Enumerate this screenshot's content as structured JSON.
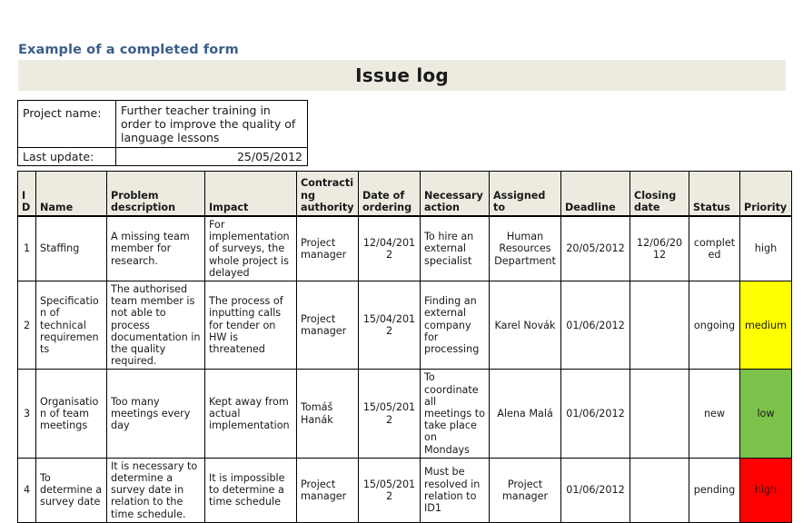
{
  "page": {
    "heading": "Example of a completed form",
    "title": "Issue log",
    "heading_color": "#3c5d8a",
    "banner_color": "#edebe0"
  },
  "info_box": {
    "project_name_label": "Project name:",
    "project_name_value": "Further teacher training in order to improve the quality of language lessons",
    "last_update_label": "Last update:",
    "last_update_value": "25/05/2012"
  },
  "table": {
    "headers": [
      "ID",
      "Name",
      "Problem description",
      "Impact",
      "Contracting authority",
      "Date of ordering",
      "Necessary action",
      "Assigned to",
      "Deadline",
      "Closing date",
      "Status",
      "Priority"
    ],
    "rows": [
      {
        "id": "1",
        "name": "Staffing",
        "problem": "A missing team member for research.",
        "impact": "For implementation of surveys, the whole project is delayed",
        "contracting_authority": "Project manager",
        "date_of_ordering": "12/04/2012",
        "necessary_action": "To hire an external specialist",
        "assigned_to": "Human Resources Department",
        "deadline": "20/05/2012",
        "closing_date": "12/06/2012",
        "status": "completed",
        "priority": "high",
        "priority_color": "#ffffff"
      },
      {
        "id": "2",
        "name": "Specification of technical requirements",
        "problem": "The authorised team member is not able to process documentation in the quality required.",
        "impact": "The process of inputting calls for tender on HW is threatened",
        "contracting_authority": "Project manager",
        "date_of_ordering": "15/04/2012",
        "necessary_action": "Finding an external company for processing",
        "assigned_to": "Karel Novák",
        "deadline": "01/06/2012",
        "closing_date": "",
        "status": "ongoing",
        "priority": "medium",
        "priority_color": "#ffff00"
      },
      {
        "id": "3",
        "name": "Organisation of team meetings",
        "problem": "Too many meetings every day",
        "impact": "Kept away from actual implementation",
        "contracting_authority": "Tomáš Hanák",
        "date_of_ordering": "15/05/2012",
        "necessary_action": "To coordinate all meetings to take place on Mondays",
        "assigned_to": "Alena Malá",
        "deadline": "01/06/2012",
        "closing_date": "",
        "status": "new",
        "priority": "low",
        "priority_color": "#7cc14b"
      },
      {
        "id": "4",
        "name": "To determine a survey date",
        "problem": "It is necessary to determine a survey date in relation to the time schedule.",
        "impact": "It is impossible to determine a time schedule",
        "contracting_authority": "Project manager",
        "date_of_ordering": "15/05/2012",
        "necessary_action": "Must be resolved in relation to ID1",
        "assigned_to": "Project manager",
        "deadline": "01/06/2012",
        "closing_date": "",
        "status": "pending",
        "priority": "high",
        "priority_color": "#ff0000"
      }
    ]
  }
}
